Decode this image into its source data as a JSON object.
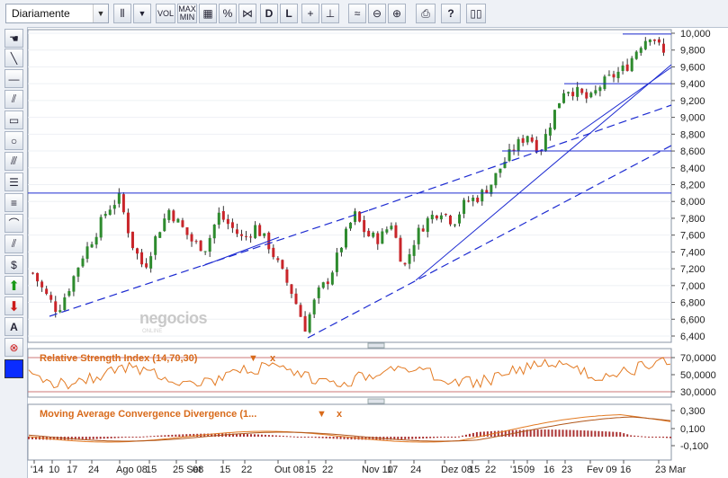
{
  "toolbar": {
    "period_value": "Diariamente",
    "volume_label": "VOL",
    "maxmin_label": "MAX MIN",
    "percent_label": "%",
    "log_label": "L",
    "help_label": "?"
  },
  "left_tools": {
    "text_tool_label": "A"
  },
  "watermark": {
    "text": "negocios",
    "subtext": "ONLINE"
  },
  "main_chart": {
    "y_ticks": [
      "10,000",
      "9,800",
      "9,600",
      "9,400",
      "9,200",
      "9,000",
      "8,800",
      "8,600",
      "8,400",
      "8,200",
      "8,000",
      "7,800",
      "7,600",
      "7,400",
      "7,200",
      "7,000",
      "6,800",
      "6,600",
      "6,400"
    ]
  },
  "rsi": {
    "title": "Relative Strength Index (14,70,30)",
    "menu_arrow": "▼",
    "close": "x",
    "y_ticks": [
      "70,0000",
      "50,0000",
      "30,0000"
    ]
  },
  "macd": {
    "title": "Moving Average Convergence Divergence (1...",
    "menu_arrow": "▼",
    "close": "x",
    "y_ticks": [
      "0,300",
      "0,100",
      "-0,100"
    ]
  },
  "x_axis": {
    "labels": [
      "'14",
      "10",
      "17",
      "24",
      "Ago 08",
      "15",
      "25 Set",
      "08",
      "15",
      "22",
      "Out 08",
      "15",
      "22",
      "Nov 10",
      "17",
      "24",
      "Dez 08",
      "15",
      "22",
      "'15",
      "09",
      "16",
      "23",
      "Fev 09",
      "16",
      "23 Mar"
    ]
  },
  "chart_data": {
    "type": "candlestick",
    "price_range": [
      6400,
      10000
    ],
    "horizontal_levels": [
      9400,
      8600,
      8100
    ],
    "approx_path": [
      7150,
      6900,
      6700,
      7000,
      7350,
      7600,
      7900,
      8050,
      7500,
      7200,
      7600,
      7900,
      7700,
      7500,
      7450,
      7850,
      7700,
      7550,
      7700,
      7500,
      7200,
      6900,
      6500,
      6900,
      7100,
      7500,
      7850,
      7600,
      7550,
      7750,
      7200,
      7600,
      7800,
      7900,
      7750,
      8000,
      8050,
      8200,
      8450,
      8650,
      8800,
      8600,
      9000,
      9350,
      9300,
      9200,
      9400,
      9500,
      9600,
      9850,
      10000,
      9750
    ]
  },
  "colors": {
    "up": "#2e8b2e",
    "down": "#c9252a",
    "trend": "#1d2bd1",
    "indicator": "#e37a22"
  }
}
